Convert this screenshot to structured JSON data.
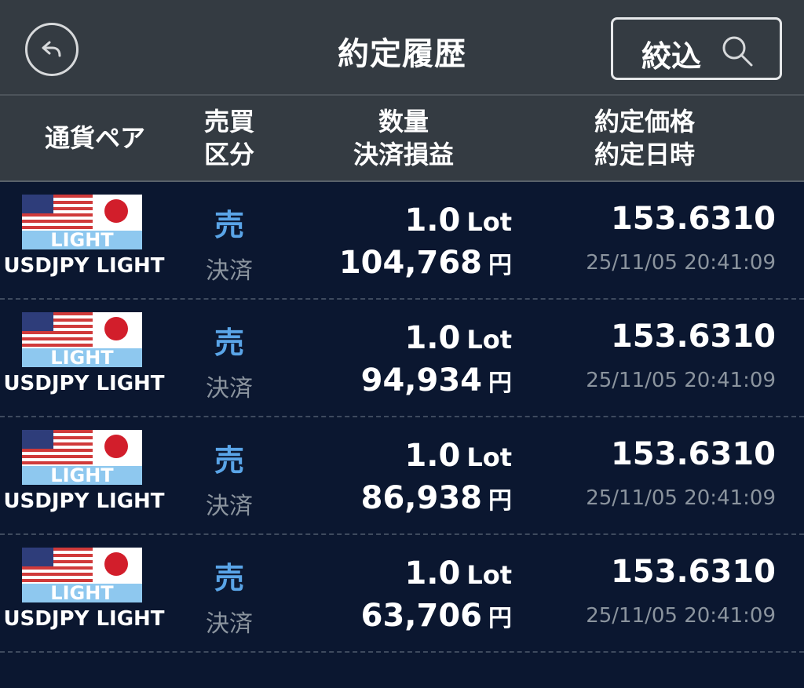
{
  "nav": {
    "title": "約定履歴",
    "filter_label": "絞込"
  },
  "header": {
    "pair": "通貨ペア",
    "side_line1": "売買",
    "side_line2": "区分",
    "qty_line1": "数量",
    "qty_line2": "決済損益",
    "price_line1": "約定価格",
    "price_line2": "約定日時"
  },
  "colors": {
    "background": "#0b1730",
    "bar": "#343b42",
    "sell": "#5aa5e8",
    "muted": "#8b949e"
  },
  "rows": [
    {
      "flag_label": "LIGHT",
      "pair": "USDJPY LIGHT",
      "side": "売",
      "type": "決済",
      "qty": "1.0",
      "qty_unit": "Lot",
      "pl": "104,768",
      "pl_unit": "円",
      "price": "153.6310",
      "datetime": "25/11/05 20:41:09"
    },
    {
      "flag_label": "LIGHT",
      "pair": "USDJPY LIGHT",
      "side": "売",
      "type": "決済",
      "qty": "1.0",
      "qty_unit": "Lot",
      "pl": "94,934",
      "pl_unit": "円",
      "price": "153.6310",
      "datetime": "25/11/05 20:41:09"
    },
    {
      "flag_label": "LIGHT",
      "pair": "USDJPY LIGHT",
      "side": "売",
      "type": "決済",
      "qty": "1.0",
      "qty_unit": "Lot",
      "pl": "86,938",
      "pl_unit": "円",
      "price": "153.6310",
      "datetime": "25/11/05 20:41:09"
    },
    {
      "flag_label": "LIGHT",
      "pair": "USDJPY LIGHT",
      "side": "売",
      "type": "決済",
      "qty": "1.0",
      "qty_unit": "Lot",
      "pl": "63,706",
      "pl_unit": "円",
      "price": "153.6310",
      "datetime": "25/11/05 20:41:09"
    }
  ]
}
